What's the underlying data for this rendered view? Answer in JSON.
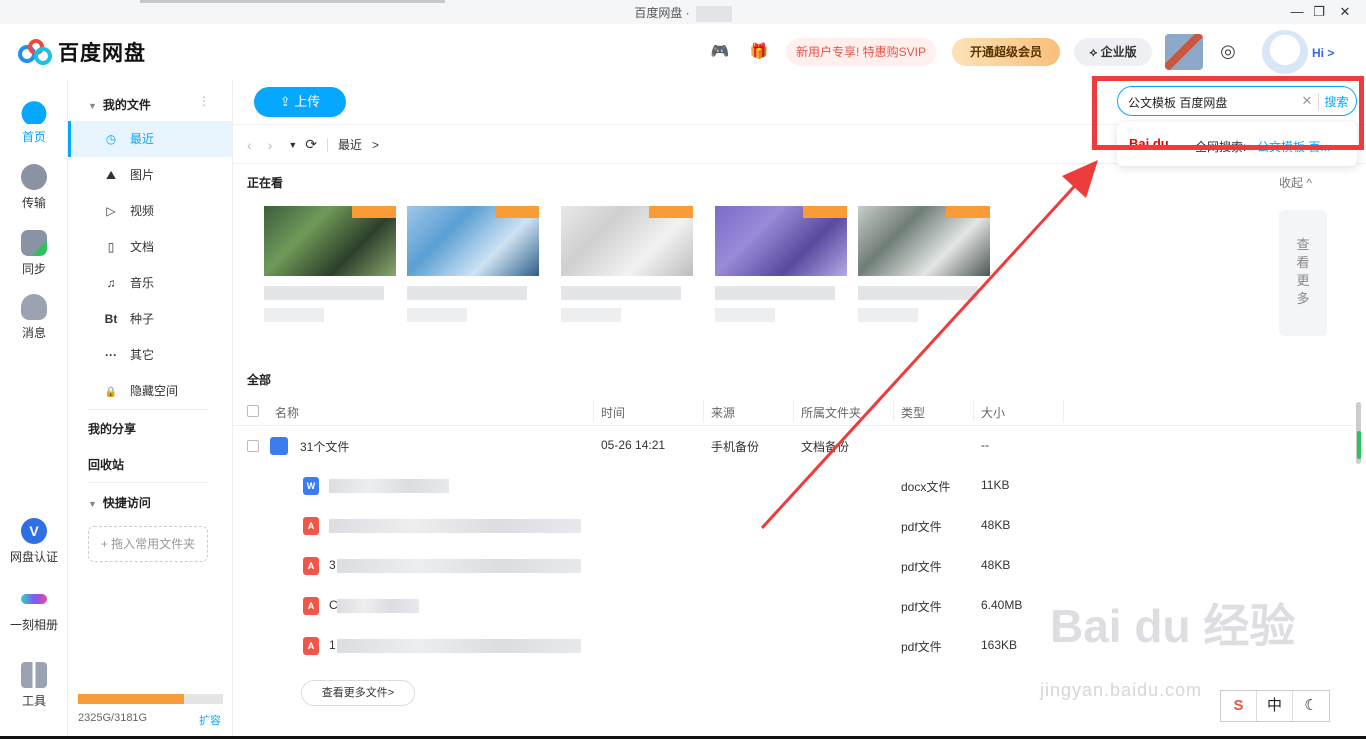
{
  "window": {
    "title": "百度网盘 ·",
    "minimize": "—",
    "restore": "❐",
    "close": "✕"
  },
  "header": {
    "logo_text": "百度网盘",
    "promo": "新用户专享! 特惠购SVIP",
    "svip_label": "开通超级会员",
    "enterprise_label": "企业版",
    "hi_label": "Hi >",
    "brand_color": "#06a7ff"
  },
  "rail": {
    "items": [
      {
        "label": "首页",
        "icon": "cloud-icon"
      },
      {
        "label": "传输",
        "icon": "transfer-icon"
      },
      {
        "label": "同步",
        "icon": "sync-icon"
      },
      {
        "label": "消息",
        "icon": "message-icon"
      },
      {
        "label": "网盘认证",
        "icon": "verify-icon"
      },
      {
        "label": "一刻相册",
        "icon": "album-icon"
      },
      {
        "label": "工具",
        "icon": "tools-icon"
      }
    ]
  },
  "nav": {
    "my_files": "我的文件",
    "items": [
      {
        "label": "最近",
        "icon": "◷"
      },
      {
        "label": "图片",
        "icon": "⛰"
      },
      {
        "label": "视频",
        "icon": "▷"
      },
      {
        "label": "文档",
        "icon": "▯"
      },
      {
        "label": "音乐",
        "icon": "♫"
      },
      {
        "label": "种子",
        "icon": "Bt"
      },
      {
        "label": "其它",
        "icon": "···"
      },
      {
        "label": "隐藏空间",
        "icon": "🔒"
      }
    ],
    "my_share": "我的分享",
    "recycle": "回收站",
    "quick_access": "快捷访问",
    "quick_drop": "+ 拖入常用文件夹",
    "quota_text": "2325G/3181G",
    "quota_fraction": 0.73,
    "expand": "扩容"
  },
  "main": {
    "upload_label": "上传",
    "path_current": "最近",
    "path_arrow": ">",
    "watching_title": "正在看",
    "collapse": "收起 ^",
    "see_more": [
      "查",
      "看",
      "更",
      "多"
    ],
    "all_title": "全部",
    "columns": [
      "名称",
      "时间",
      "来源",
      "所属文件夹",
      "类型",
      "大小"
    ],
    "group_row": {
      "name": "31个文件",
      "time": "05-26 14:21",
      "source": "手机备份",
      "folder": "文档备份",
      "size": "--"
    },
    "files": [
      {
        "prefix": "",
        "kind": "docx",
        "type": "docx文件",
        "size": "11KB"
      },
      {
        "prefix": "",
        "kind": "pdf",
        "type": "pdf文件",
        "size": "48KB"
      },
      {
        "prefix": "3",
        "kind": "pdf",
        "type": "pdf文件",
        "size": "48KB"
      },
      {
        "prefix": "C",
        "kind": "pdf",
        "type": "pdf文件",
        "size": "6.40MB"
      },
      {
        "prefix": "1",
        "kind": "pdf",
        "type": "pdf文件",
        "size": "163KB"
      }
    ],
    "more_files": "查看更多文件>"
  },
  "search": {
    "value": "公文模板 百度网盘",
    "button": "搜索",
    "suggest_logo": "Bai du",
    "suggest_text": "全网搜索:",
    "suggest_value": "公文模板 百..."
  },
  "ime": {
    "s": "S",
    "zh": "中",
    "moon": "☾"
  },
  "watermark": {
    "main": "Bai du 经验",
    "url": "jingyan.baidu.com"
  }
}
